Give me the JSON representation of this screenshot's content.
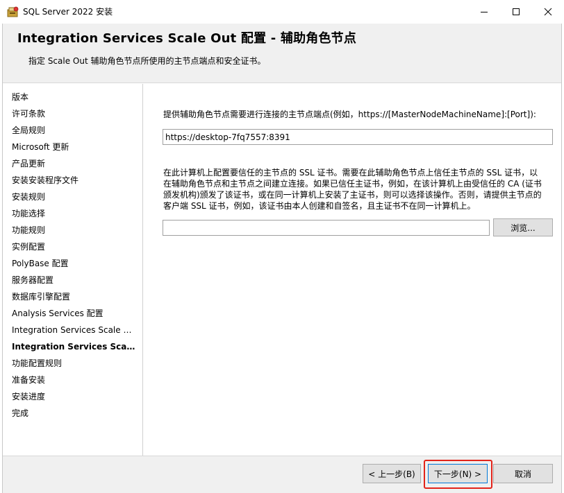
{
  "window": {
    "title": "SQL Server 2022 安装",
    "icon": "sql-server-setup-icon"
  },
  "header": {
    "title": "Integration  Services  Scale  Out 配置 - 辅助角色节点",
    "description": "指定 Scale Out 辅助角色节点所使用的主节点端点和安全证书。"
  },
  "sidebar": {
    "items": [
      {
        "label": "版本",
        "active": false
      },
      {
        "label": "许可条款",
        "active": false
      },
      {
        "label": "全局规则",
        "active": false
      },
      {
        "label": "Microsoft 更新",
        "active": false
      },
      {
        "label": "产品更新",
        "active": false
      },
      {
        "label": "安装安装程序文件",
        "active": false
      },
      {
        "label": "安装规则",
        "active": false
      },
      {
        "label": "功能选择",
        "active": false
      },
      {
        "label": "功能规则",
        "active": false
      },
      {
        "label": "实例配置",
        "active": false
      },
      {
        "label": "PolyBase 配置",
        "active": false
      },
      {
        "label": "服务器配置",
        "active": false
      },
      {
        "label": "数据库引擎配置",
        "active": false
      },
      {
        "label": "Analysis Services 配置",
        "active": false
      },
      {
        "label": "Integration Services Scale O...",
        "active": false
      },
      {
        "label": "Integration Services Scale ...",
        "active": true
      },
      {
        "label": "功能配置规则",
        "active": false
      },
      {
        "label": "准备安装",
        "active": false
      },
      {
        "label": "安装进度",
        "active": false
      },
      {
        "label": "完成",
        "active": false
      }
    ]
  },
  "content": {
    "master_label": "提供辅助角色节点需要进行连接的主节点端点(例如，https://[MasterNodeMachineName]:[Port]):",
    "master_value": "https://desktop-7fq7557:8391",
    "cert_description": "在此计算机上配置要信任的主节点的 SSL 证书。需要在此辅助角色节点上信任主节点的 SSL 证书，以在辅助角色节点和主节点之间建立连接。如果已信任主证书，例如，在该计算机上由受信任的 CA (证书颁发机构)颁发了该证书，或在同一计算机上安装了主证书，则可以选择该操作。否则，请提供主节点的客户端 SSL 证书，例如，该证书由本人创建和自签名，且主证书不在同一计算机上。",
    "cert_value": "",
    "browse_label": "浏览..."
  },
  "footer": {
    "back_label": "< 上一步(B)",
    "next_label": "下一步(N) >",
    "cancel_label": "取消"
  },
  "colors": {
    "highlight": "#e2231a",
    "header_bg": "#f0f0f0",
    "focus_border": "#0078d7"
  }
}
